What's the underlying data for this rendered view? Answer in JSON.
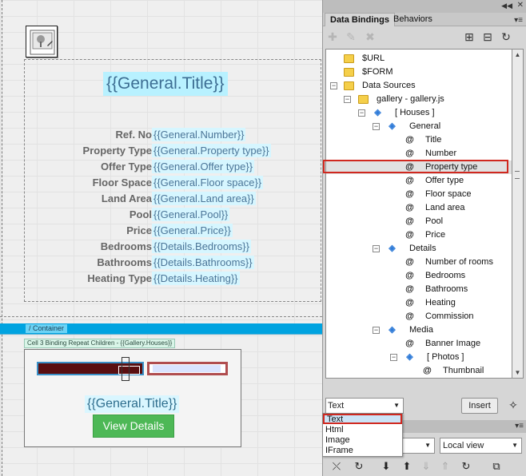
{
  "canvas": {
    "title_binding": "{{General.Title}}",
    "fields": [
      {
        "label": "Ref. No",
        "value": "{{General.Number}}"
      },
      {
        "label": "Property Type",
        "value": "{{General.Property type}}"
      },
      {
        "label": "Offer Type",
        "value": "{{General.Offer type}}"
      },
      {
        "label": "Floor Space",
        "value": "{{General.Floor space}}"
      },
      {
        "label": "Land Area",
        "value": "{{General.Land area}}"
      },
      {
        "label": "Pool",
        "value": "{{General.Pool}}"
      },
      {
        "label": "Price",
        "value": "{{General.Price}}"
      },
      {
        "label": "Bedrooms",
        "value": "{{Details.Bedrooms}}"
      },
      {
        "label": "Bathrooms",
        "value": "{{Details.Bathrooms}}"
      },
      {
        "label": "Heating Type",
        "value": "{{Details.Heating}}"
      }
    ],
    "container_tag": "/ Container",
    "repeat_tag": "Cell 3 Binding Repeat Children - {{Gallery.Houses}}",
    "card_title": "{{General.Title}}",
    "view_button": "View Details"
  },
  "panel": {
    "tabs": [
      "Data Bindings",
      "Behaviors"
    ],
    "tree": [
      {
        "label": "$URL",
        "type": "folder"
      },
      {
        "label": "$FORM",
        "type": "folder"
      },
      {
        "label": "Data Sources",
        "type": "folder"
      },
      {
        "label": "gallery - gallery.js",
        "type": "folder"
      },
      {
        "label": "[ Houses ]",
        "type": "array"
      },
      {
        "label": "General",
        "type": "object"
      },
      {
        "label": "Title",
        "type": "field"
      },
      {
        "label": "Number",
        "type": "field"
      },
      {
        "label": "Property type",
        "type": "field",
        "selected": true
      },
      {
        "label": "Offer type",
        "type": "field"
      },
      {
        "label": "Floor space",
        "type": "field"
      },
      {
        "label": "Land area",
        "type": "field"
      },
      {
        "label": "Pool",
        "type": "field"
      },
      {
        "label": "Price",
        "type": "field"
      },
      {
        "label": "Details",
        "type": "object"
      },
      {
        "label": "Number of rooms",
        "type": "field"
      },
      {
        "label": "Bedrooms",
        "type": "field"
      },
      {
        "label": "Bathrooms",
        "type": "field"
      },
      {
        "label": "Heating",
        "type": "field"
      },
      {
        "label": "Commission",
        "type": "field"
      },
      {
        "label": "Media",
        "type": "object"
      },
      {
        "label": "Banner Image",
        "type": "field"
      },
      {
        "label": "[ Photos ]",
        "type": "array"
      },
      {
        "label": "Thumbnail",
        "type": "field"
      }
    ],
    "format_select": "Text",
    "insert_button": "Insert",
    "format_options": [
      "Text",
      "Html",
      "Image",
      "IFrame"
    ],
    "view_select": "Local view",
    "colors": {
      "selection_outline": "#d0281f",
      "binding_highlight": "#b8f1ff",
      "button_green": "#4db856"
    }
  }
}
